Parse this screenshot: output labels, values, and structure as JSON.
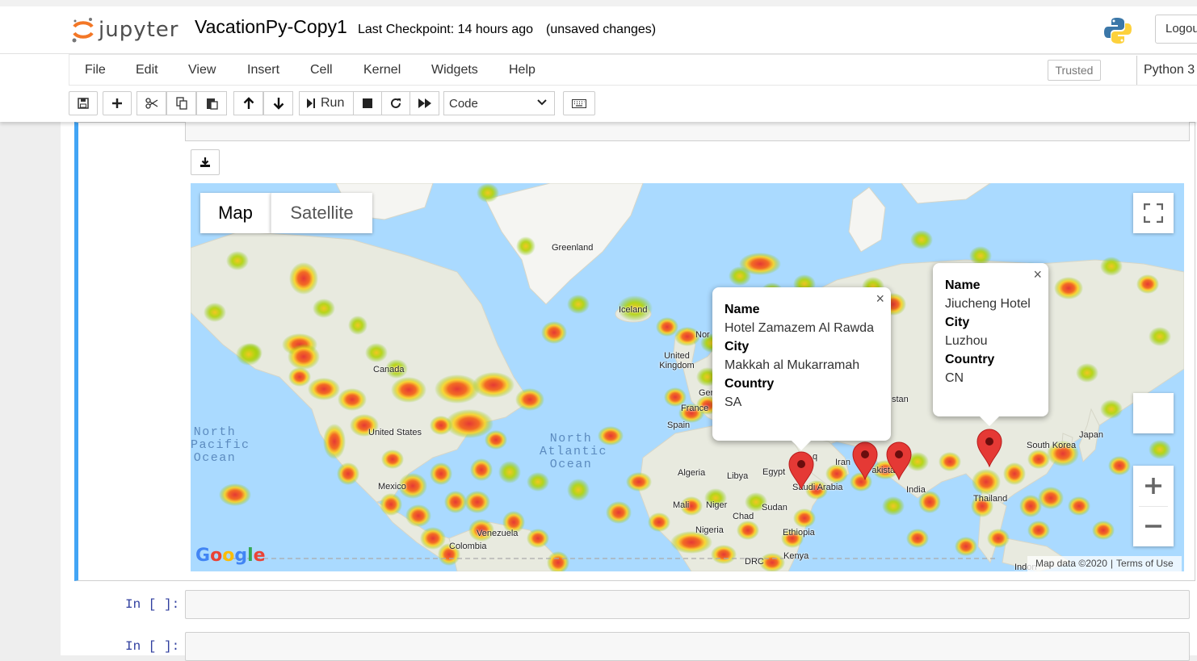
{
  "header": {
    "logo_text": "jupyter",
    "notebook_title": "VacationPy-Copy1",
    "checkpoint": "Last Checkpoint: 14 hours ago",
    "status": "(unsaved changes)",
    "logout_label": "Logout"
  },
  "menu": {
    "items": [
      "File",
      "Edit",
      "View",
      "Insert",
      "Cell",
      "Kernel",
      "Widgets",
      "Help"
    ],
    "trusted": "Trusted",
    "kernel": "Python 3"
  },
  "toolbar": {
    "run_label": "Run",
    "cell_type": "Code",
    "icons": [
      "save-icon",
      "plus-icon",
      "cut-icon",
      "copy-icon",
      "paste-icon",
      "arrow-up-icon",
      "arrow-down-icon",
      "run-icon",
      "stop-icon",
      "restart-icon",
      "fast-forward-icon",
      "keyboard-icon"
    ]
  },
  "map": {
    "type_buttons": [
      "Map",
      "Satellite"
    ],
    "attribution": "Map data ©2020",
    "terms": "Terms of Use",
    "google": "Google",
    "labels": [
      "Greenland",
      "Iceland",
      "Canada",
      "United States",
      "Mexico",
      "United Kingdom",
      "France",
      "Spain",
      "Nor",
      "Ger",
      "Algeria",
      "Libya",
      "Egypt",
      "Mali",
      "Niger",
      "Chad",
      "Sudan",
      "Nigeria",
      "Ethiopia",
      "Kenya",
      "DRC",
      "Venezuela",
      "Colombia",
      "Saudi Arabia",
      "Iran",
      "Pakistan",
      "India",
      "Thailand",
      "South Korea",
      "Japan",
      "stan",
      "q",
      "Indon"
    ],
    "oceans": [
      "North Pacific Ocean",
      "North Atlantic Ocean"
    ],
    "heat_colors": [
      "#e53935",
      "#f9a825",
      "#7cc300"
    ],
    "marker_color": "#e53935",
    "info_windows": [
      {
        "fields": [
          {
            "label": "Name",
            "value": "Hotel Zamazem Al Rawda"
          },
          {
            "label": "City",
            "value": "Makkah al Mukarramah"
          },
          {
            "label": "Country",
            "value": "SA"
          }
        ]
      },
      {
        "fields": [
          {
            "label": "Name",
            "value": "Jiucheng Hotel"
          },
          {
            "label": "City",
            "value": "Luzhou"
          },
          {
            "label": "Country",
            "value": "CN"
          }
        ]
      }
    ]
  },
  "cells": [
    {
      "prompt": "In [ ]:"
    },
    {
      "prompt": "In [ ]:"
    }
  ]
}
